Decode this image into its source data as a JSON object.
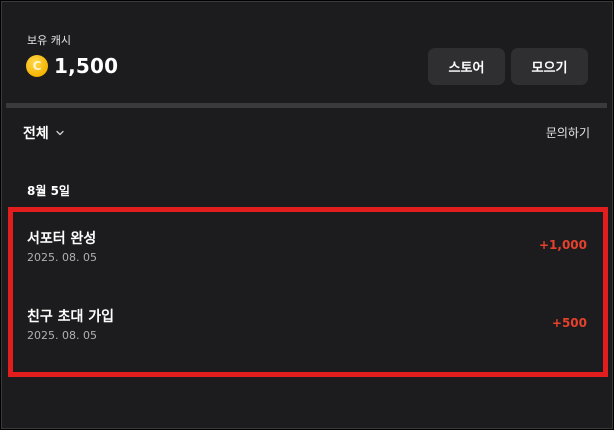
{
  "header": {
    "cash_label": "보유 캐시",
    "balance": "1,500",
    "coin_glyph": "C",
    "store_label": "스토어",
    "collect_label": "모으기"
  },
  "filter": {
    "label": "전체",
    "icon": "chevron-down-icon"
  },
  "inquiry_label": "문의하기",
  "history": {
    "date_header": "8월 5일",
    "items": [
      {
        "title": "서포터 완성",
        "date": "2025. 08. 05",
        "amount": "+1,000"
      },
      {
        "title": "친구 초대 가입",
        "date": "2025. 08. 05",
        "amount": "+500"
      }
    ]
  },
  "colors": {
    "background": "#1c1c1e",
    "button": "#2f2f31",
    "amount": "#e5412c",
    "highlight": "#e21d1d",
    "coin": "#f5b400"
  }
}
